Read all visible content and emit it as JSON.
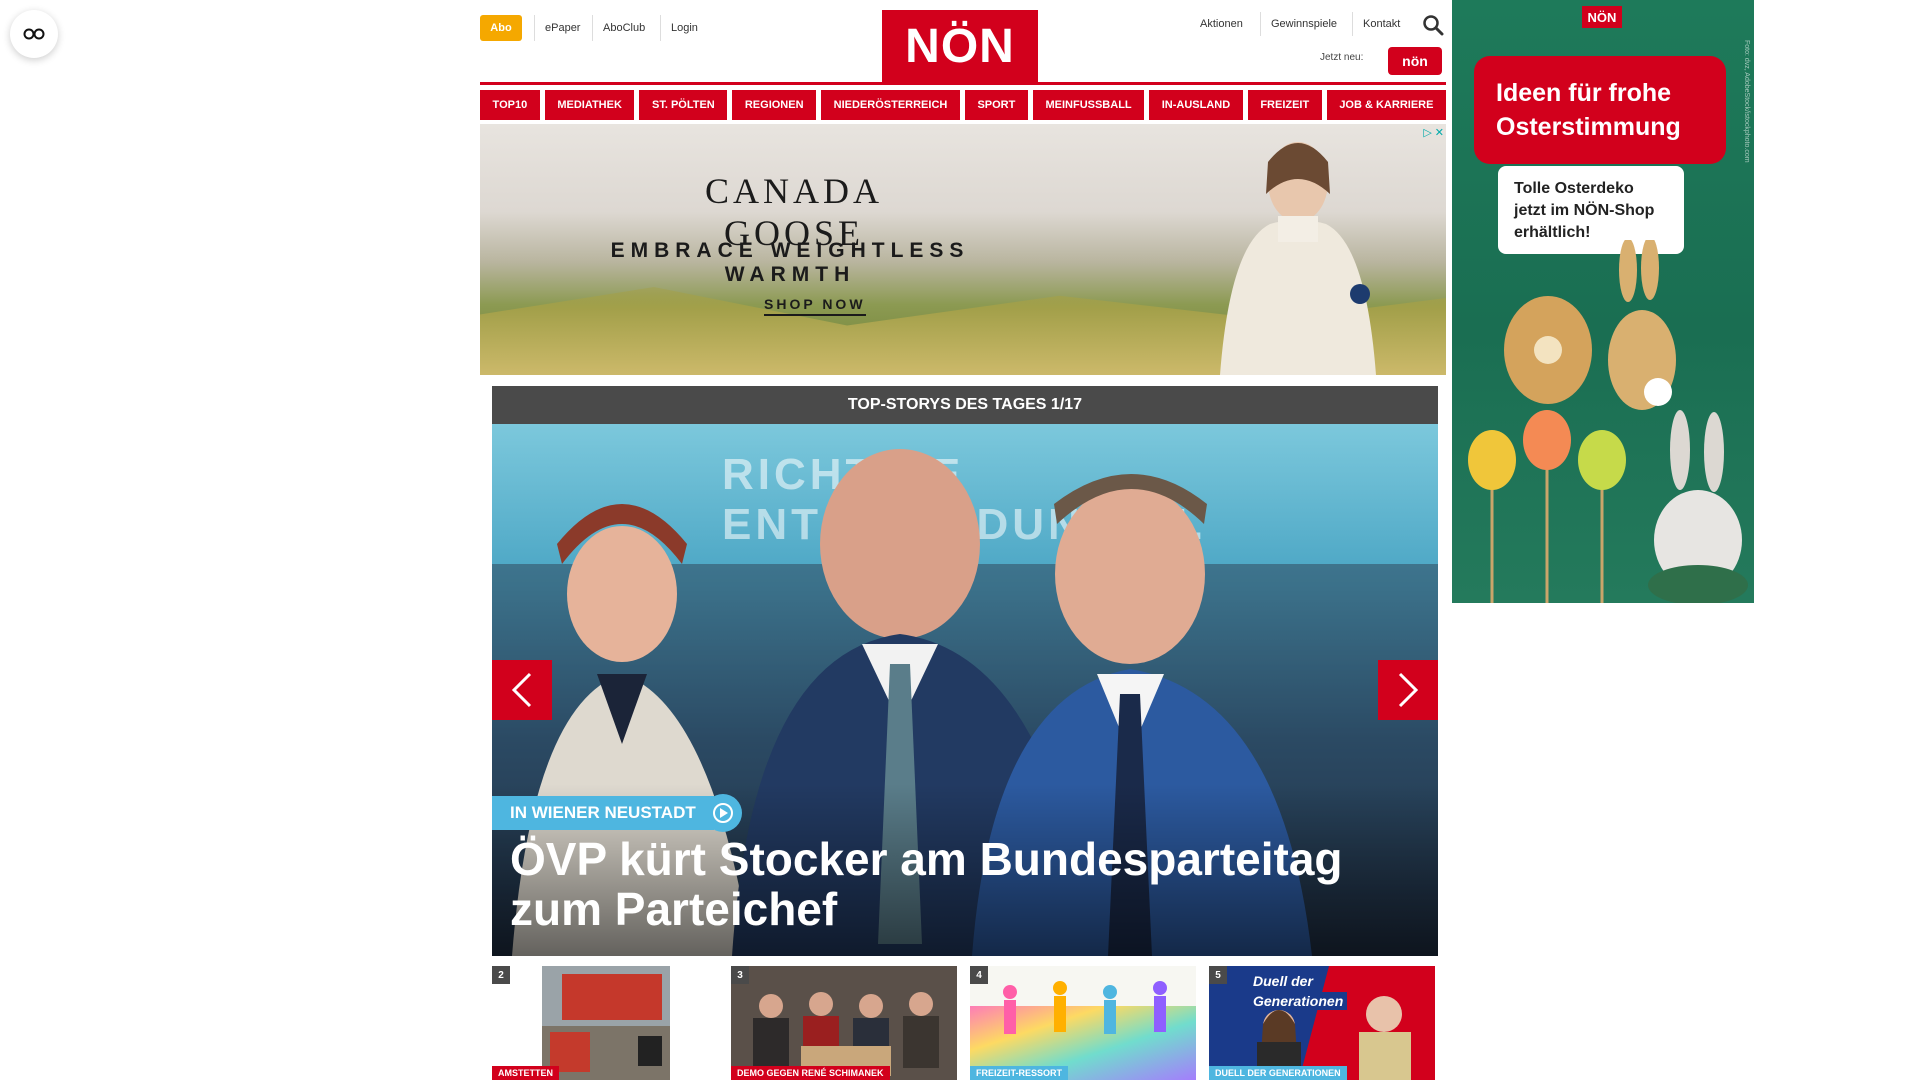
{
  "header": {
    "abo_label": "Abo",
    "left_links": [
      "ePaper",
      "AboClub",
      "Login"
    ],
    "logo_text": "NÖN",
    "right_links": [
      "Aktionen",
      "Gewinnspiele",
      "Kontakt"
    ],
    "jetzt_neu_label": "Jetzt neu:",
    "jetzt_badge_text": "nön"
  },
  "nav": {
    "items": [
      "TOP10",
      "MEDIATHEK",
      "ST. PÖLTEN",
      "REGIONEN",
      "NIEDERÖSTERREICH",
      "SPORT",
      "MEINFUSSBALL",
      "IN-AUSLAND",
      "FREIZEIT",
      "JOB & KARRIERE"
    ]
  },
  "ad_banner": {
    "brand": "CANADA GOOSE",
    "tagline": "EMBRACE WEIGHTLESS WARMTH",
    "cta": "SHOP NOW"
  },
  "top_stories": {
    "header": "TOP-STORYS DES TAGES 1/17",
    "background_text": "RICHTIGE ENTSCHEIDUNGEN.",
    "kicker": "IN WIENER NEUSTADT",
    "title": "ÖVP kürt Stocker am Bundesparteitag zum Parteichef",
    "thumbnails": [
      {
        "num": "2",
        "tag": "AMSTETTEN",
        "tag_color": "#d2001c"
      },
      {
        "num": "3",
        "tag": "DEMO GEGEN RENÉ SCHIMANEK",
        "tag_color": "#d2001c"
      },
      {
        "num": "4",
        "tag": "FREIZEIT-RESSORT",
        "tag_color": "#4eb6e0"
      },
      {
        "num": "5",
        "tag": "DUELL DER GENERATIONEN",
        "tag_color": "#4eb6e0",
        "overlay_line1": "Duell der",
        "overlay_line2": "Generationen"
      }
    ]
  },
  "side_ad": {
    "logo": "NÖN",
    "headline": "Ideen für frohe Osterstimmung",
    "body": "Tolle Osterdeko jetzt im NÖN-Shop erhältlich!",
    "credit": "Foto: dvz, AdobeStock/istockphoto.com"
  },
  "colors": {
    "brand_red": "#d2001c",
    "abo_orange": "#f5a800",
    "kicker_blue": "#4eb6e0",
    "header_gray": "#4a4a4a"
  }
}
